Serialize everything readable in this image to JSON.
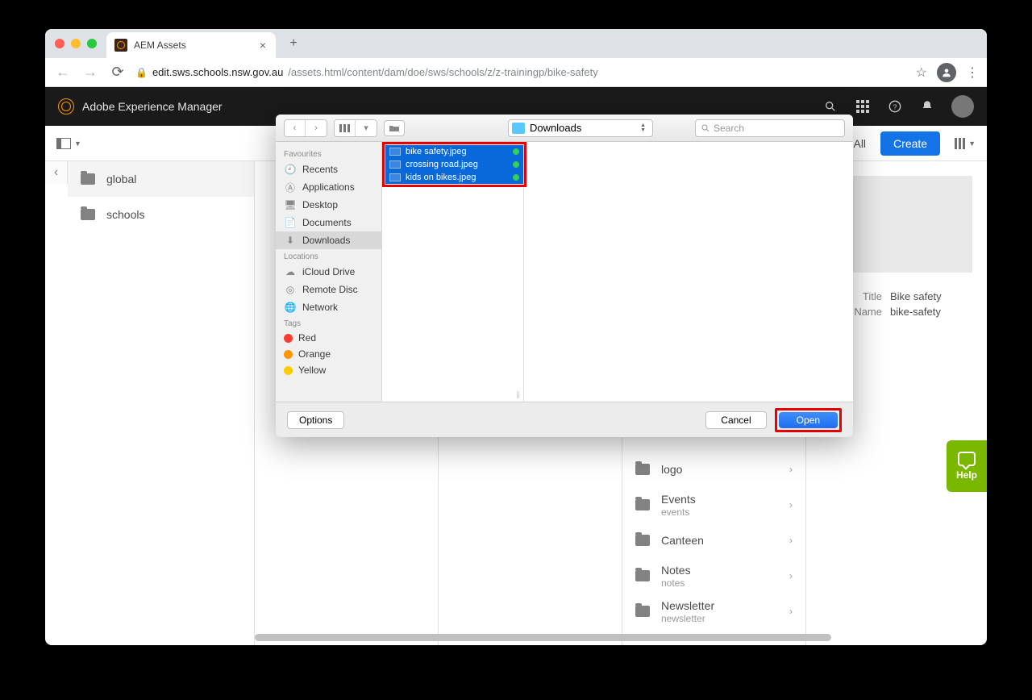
{
  "browser": {
    "tab_title": "AEM Assets",
    "url_secure_host": "edit.sws.schools.nsw.gov.au",
    "url_path": "/assets.html/content/dam/doe/sws/schools/z/z-trainingp/bike-safety"
  },
  "aem": {
    "header_title": "Adobe Experience Manager",
    "select_all": "Select All",
    "create": "Create",
    "columns": {
      "level1": [
        {
          "label": "global"
        },
        {
          "label": "schools"
        }
      ],
      "folders": [
        {
          "label": "logo",
          "sub": ""
        },
        {
          "label": "Events",
          "sub": "events"
        },
        {
          "label": "Canteen",
          "sub": ""
        },
        {
          "label": "Notes",
          "sub": "notes"
        },
        {
          "label": "Newsletter",
          "sub": "newsletter"
        }
      ]
    },
    "detail": {
      "title_k": "Title",
      "title_v": "Bike safety",
      "name_k": "Name",
      "name_v": "bike-safety"
    },
    "help": "Help"
  },
  "dialog": {
    "path_label": "Downloads",
    "search_placeholder": "Search",
    "sections": {
      "favourites": "Favourites",
      "locations": "Locations",
      "tags": "Tags"
    },
    "favourites": [
      {
        "label": "Recents",
        "icon": "clock"
      },
      {
        "label": "Applications",
        "icon": "apps"
      },
      {
        "label": "Desktop",
        "icon": "desktop"
      },
      {
        "label": "Documents",
        "icon": "doc"
      },
      {
        "label": "Downloads",
        "icon": "down",
        "active": true
      }
    ],
    "locations": [
      {
        "label": "iCloud Drive",
        "icon": "cloud"
      },
      {
        "label": "Remote Disc",
        "icon": "disc"
      },
      {
        "label": "Network",
        "icon": "globe"
      }
    ],
    "tags": [
      {
        "label": "Red",
        "color": "#ff3b30"
      },
      {
        "label": "Orange",
        "color": "#ff9500"
      },
      {
        "label": "Yellow",
        "color": "#ffcc00"
      }
    ],
    "files": [
      {
        "label": "bike safety.jpeg"
      },
      {
        "label": "crossing road.jpeg"
      },
      {
        "label": "kids on bikes.jpeg"
      }
    ],
    "options": "Options",
    "cancel": "Cancel",
    "open": "Open"
  }
}
